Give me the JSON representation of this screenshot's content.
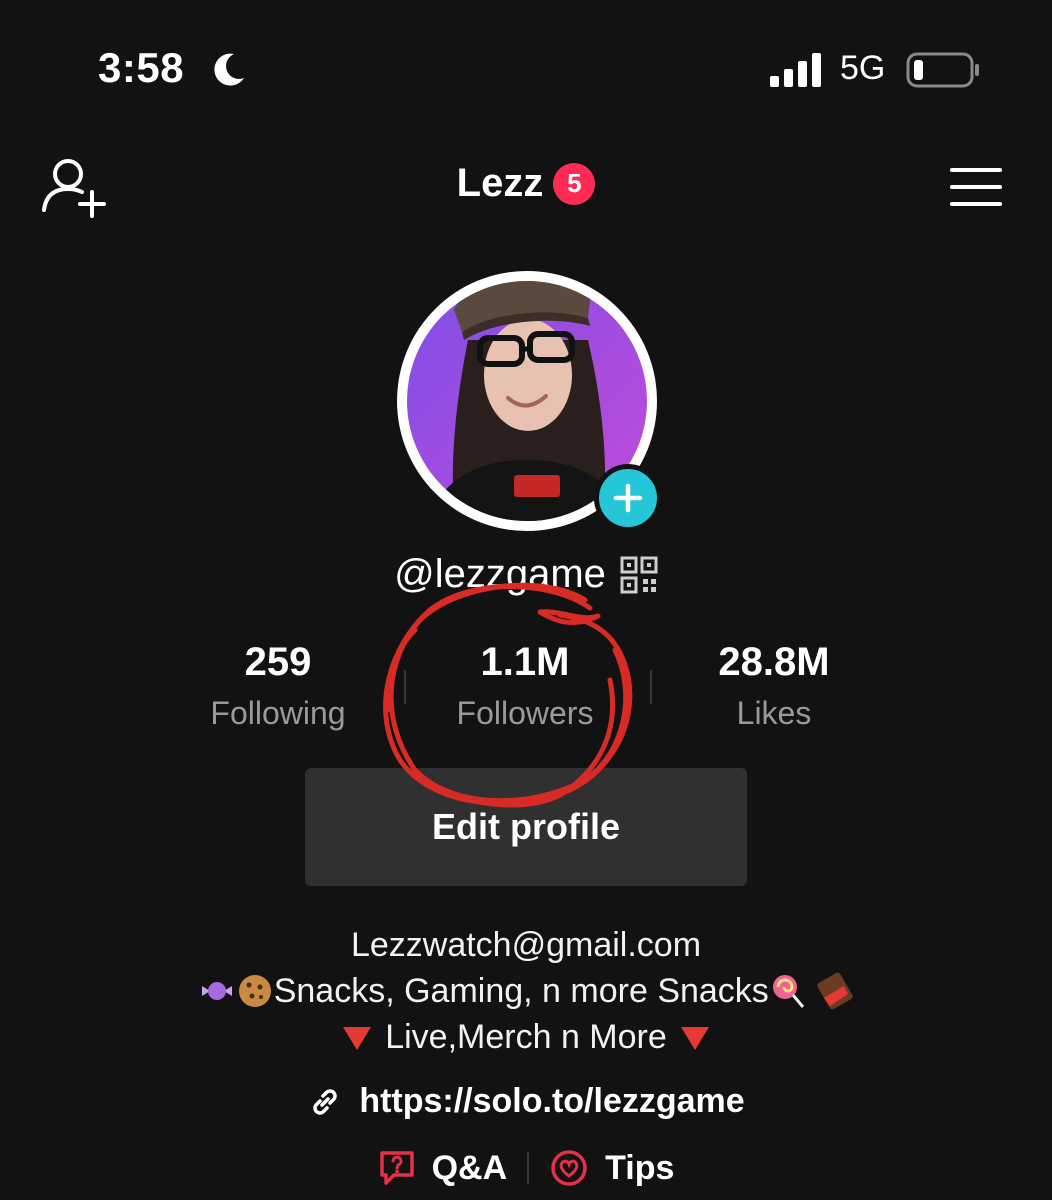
{
  "status_bar": {
    "time": "3:58",
    "network": "5G"
  },
  "header": {
    "title": "Lezz",
    "badge": "5"
  },
  "profile": {
    "username": "@lezzgame"
  },
  "stats": [
    {
      "value": "259",
      "label": "Following"
    },
    {
      "value": "1.1M",
      "label": "Followers"
    },
    {
      "value": "28.8M",
      "label": "Likes"
    }
  ],
  "edit_button": {
    "label": "Edit profile"
  },
  "bio": {
    "line1": "Lezzwatch@gmail.com",
    "line2": "Snacks, Gaming, n more Snacks",
    "line3": "Live,Merch n More"
  },
  "link": {
    "url": "https://solo.to/lezzgame"
  },
  "bottom": {
    "qa_label": "Q&A",
    "tips_label": "Tips"
  },
  "colors": {
    "background": "#121212",
    "badge": "#fe2c55",
    "accent_red": "#e5304a",
    "avatar_add": "#24c6d8"
  }
}
